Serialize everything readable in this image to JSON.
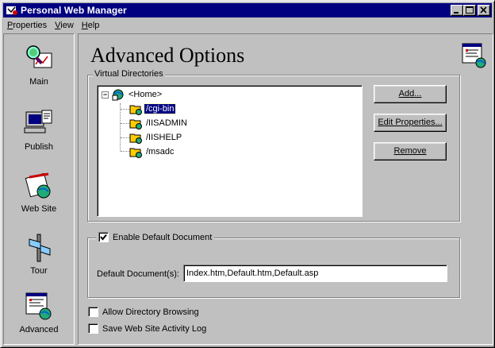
{
  "window": {
    "title": "Personal Web Manager",
    "controls": [
      "minimize",
      "maximize",
      "close"
    ]
  },
  "menu": [
    {
      "label": "Properties",
      "accel": "P"
    },
    {
      "label": "View",
      "accel": "V"
    },
    {
      "label": "Help",
      "accel": "H"
    }
  ],
  "sidebar": {
    "items": [
      {
        "label": "Main",
        "icon": "main-magnifier-chart-icon"
      },
      {
        "label": "Publish",
        "icon": "publish-computer-icon"
      },
      {
        "label": "Web Site",
        "icon": "web-site-icon"
      },
      {
        "label": "Tour",
        "icon": "tour-signpost-icon"
      },
      {
        "label": "Advanced",
        "icon": "advanced-settings-icon"
      }
    ]
  },
  "main": {
    "title": "Advanced Options",
    "virtual_directories": {
      "caption": "Virtual Directories",
      "root": "<Home>",
      "children": [
        "/cgi-bin",
        "/IISADMIN",
        "/IISHELP",
        "/msadc"
      ],
      "selected": "/cgi-bin"
    },
    "buttons": {
      "add": "Add...",
      "edit": "Edit Properties...",
      "remove": "Remove"
    },
    "default_doc": {
      "checkbox_label": "Enable Default Document",
      "checked": true,
      "field_label": "Default Document(s):",
      "value": "Index.htm,Default.htm,Default.asp"
    },
    "options": [
      {
        "label": "Allow Directory Browsing",
        "checked": false
      },
      {
        "label": "Save Web Site Activity Log",
        "checked": false
      }
    ]
  },
  "colors": {
    "titlebar": "#000080",
    "face": "#c0c0c0",
    "selection": "#000080"
  }
}
